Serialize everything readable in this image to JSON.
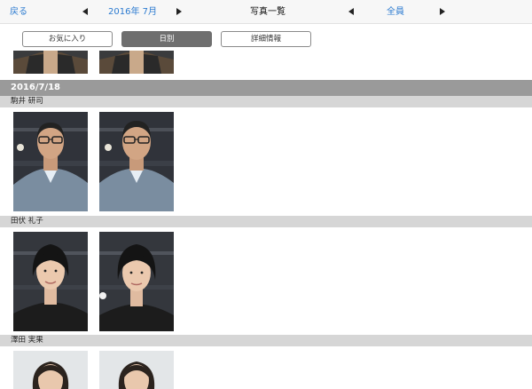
{
  "nav": {
    "back_label": "戻る",
    "month_label": "2016年 7月",
    "title": "写真一覧",
    "filter_label": "全員"
  },
  "tabs": [
    {
      "label": "お気に入り",
      "active": false
    },
    {
      "label": "日別",
      "active": true
    },
    {
      "label": "詳細情報",
      "active": false
    }
  ],
  "date_group": {
    "date": "2016/7/18"
  },
  "people": [
    {
      "name": "駒井 研司",
      "photos": 2
    },
    {
      "name": "田伏 礼子",
      "photos": 2
    },
    {
      "name": "澤田 実果",
      "photos": 2
    }
  ],
  "colors": {
    "accent": "#2c7bd0",
    "date_header_bg": "#9a9a9a",
    "name_header_bg": "#d6d6d6",
    "active_tab_bg": "#6f6f6f"
  },
  "icons": {
    "prev": "triangle-left-icon",
    "next": "triangle-right-icon"
  }
}
